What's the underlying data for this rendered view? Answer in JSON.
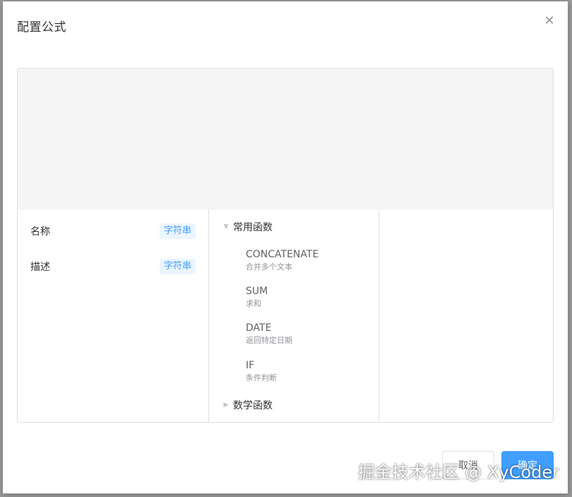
{
  "dialog": {
    "title": "配置公式",
    "close_icon": "close-icon"
  },
  "fields": [
    {
      "name": "名称",
      "type": "字符串"
    },
    {
      "name": "描述",
      "type": "字符串"
    }
  ],
  "function_groups": [
    {
      "label": "常用函数",
      "expanded": true,
      "functions": [
        {
          "name": "CONCATENATE",
          "desc": "合并多个文本"
        },
        {
          "name": "SUM",
          "desc": "求和"
        },
        {
          "name": "DATE",
          "desc": "返回特定日期"
        },
        {
          "name": "IF",
          "desc": "条件判断"
        }
      ]
    },
    {
      "label": "数学函数",
      "expanded": false,
      "functions": []
    }
  ],
  "footer": {
    "cancel_label": "取消",
    "ok_label": "确定"
  },
  "watermark": "掘金技术社区 @ XyCoder",
  "colors": {
    "primary": "#409eff",
    "tag_bg": "#ecf5ff",
    "editor_bg": "#f5f5f5",
    "border": "#dcdfe6"
  }
}
